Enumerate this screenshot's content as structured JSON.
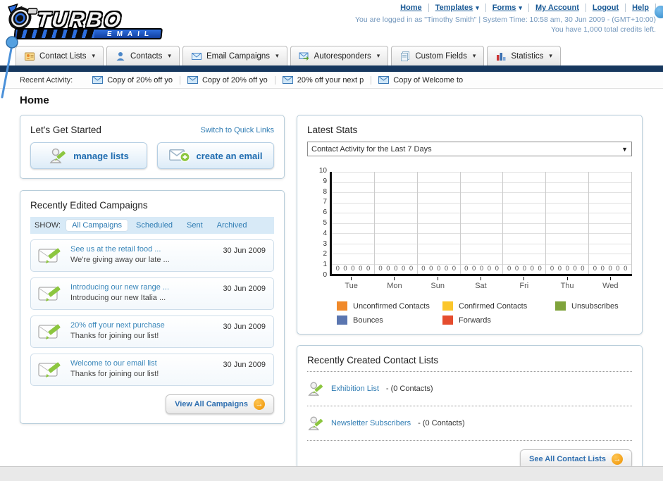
{
  "header": {
    "logo_title": "TURBO",
    "logo_subtitle": "EMAIL",
    "nav_links": [
      "Home",
      "Templates",
      "Forms",
      "My Account",
      "Logout",
      "Help"
    ],
    "login_info": "You are logged in as \"Timothy Smith\" | System Time: 10:58 am, 30 Jun 2009 - (GMT+10:00)",
    "credits_info": "You have 1,000 total credits left."
  },
  "tabs": [
    {
      "label": "Contact Lists"
    },
    {
      "label": "Contacts"
    },
    {
      "label": "Email Campaigns"
    },
    {
      "label": "Autoresponders"
    },
    {
      "label": "Custom Fields"
    },
    {
      "label": "Statistics"
    }
  ],
  "recent_activity": {
    "label": "Recent Activity:",
    "items": [
      "Copy of 20% off yo",
      "Copy of 20% off yo",
      "20% off your next p",
      "Copy of Welcome to"
    ]
  },
  "page_title": "Home",
  "get_started": {
    "title": "Let's Get Started",
    "switch_link": "Switch to Quick Links",
    "manage_lists_label": "manage lists",
    "create_email_label": "create an email"
  },
  "campaigns": {
    "title": "Recently Edited Campaigns",
    "show_label": "SHOW:",
    "filters": [
      "All Campaigns",
      "Scheduled",
      "Sent",
      "Archived"
    ],
    "active_filter": "All Campaigns",
    "items": [
      {
        "title": "See us at the retail food ...",
        "subtitle": "We're giving away our late ...",
        "date": "30 Jun 2009"
      },
      {
        "title": "Introducing our new range ...",
        "subtitle": "Introducing our new Italia ...",
        "date": "30 Jun 2009"
      },
      {
        "title": "20% off your next purchase",
        "subtitle": "Thanks for joining our list!",
        "date": "30 Jun 2009"
      },
      {
        "title": "Welcome to our email list",
        "subtitle": "Thanks for joining our list!",
        "date": "30 Jun 2009"
      }
    ],
    "view_all_label": "View All Campaigns"
  },
  "stats": {
    "title": "Latest Stats",
    "selected_option": "Contact Activity for the Last 7 Days"
  },
  "chart_data": {
    "type": "bar",
    "title": "Contact Activity for the Last 7 Days",
    "categories": [
      "Tue",
      "Mon",
      "Sun",
      "Sat",
      "Fri",
      "Thu",
      "Wed"
    ],
    "series": [
      {
        "name": "Unconfirmed Contacts",
        "color": "#F0892A",
        "values": [
          0,
          0,
          0,
          0,
          0,
          0,
          0
        ]
      },
      {
        "name": "Confirmed Contacts",
        "color": "#FBC62B",
        "values": [
          0,
          0,
          0,
          0,
          0,
          0,
          0
        ]
      },
      {
        "name": "Unsubscribes",
        "color": "#7FA33B",
        "values": [
          0,
          0,
          0,
          0,
          0,
          0,
          0
        ]
      },
      {
        "name": "Bounces",
        "color": "#5B76B0",
        "values": [
          0,
          0,
          0,
          0,
          0,
          0,
          0
        ]
      },
      {
        "name": "Forwards",
        "color": "#E54D2E",
        "values": [
          0,
          0,
          0,
          0,
          0,
          0,
          0
        ]
      }
    ],
    "ylim": [
      0,
      10
    ],
    "ytick_step": 1,
    "grid": true,
    "legend_position": "bottom",
    "data_labels": "all zeros shown along baseline"
  },
  "contact_lists": {
    "title": "Recently Created Contact Lists",
    "items": [
      {
        "name": "Exhibition List",
        "detail": "- (0 Contacts)"
      },
      {
        "name": "Newsletter Subscribers",
        "detail": "- (0 Contacts)"
      }
    ],
    "see_all_label": "See All Contact Lists"
  },
  "colors": {
    "navy_bar": "#16375E",
    "link_blue": "#2F7CB3",
    "button_text_blue": "#1F6CB0",
    "arrow_button_orange": "#EF9303",
    "pencil_green": "#8CC63F"
  }
}
